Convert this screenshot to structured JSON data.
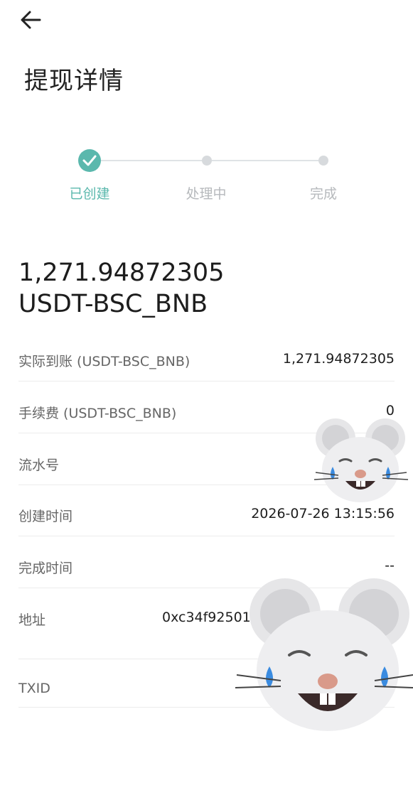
{
  "header": {
    "back_icon": "arrow-left-icon",
    "title": "提现详情"
  },
  "steps": [
    {
      "label": "已创建",
      "state": "done"
    },
    {
      "label": "处理中",
      "state": "pending"
    },
    {
      "label": "完成",
      "state": "pending"
    }
  ],
  "amount": {
    "value": "1,271.94872305",
    "currency": "USDT-BSC_BNB"
  },
  "details": {
    "received": {
      "label": "实际到账 (USDT-BSC_BNB)",
      "value": "1,271.94872305"
    },
    "fee": {
      "label": "手续费 (USDT-BSC_BNB)",
      "value": "0"
    },
    "serial": {
      "label": "流水号",
      "value": ""
    },
    "created": {
      "label": "创建时间",
      "value": "2026-07-26 13:15:56"
    },
    "completed": {
      "label": "完成时间",
      "value": "--"
    },
    "address": {
      "label": "地址",
      "value": "0xc34f92501"
    },
    "txid": {
      "label": "TXID",
      "value": ""
    }
  },
  "colors": {
    "accent": "#5bb8ad",
    "pending": "#d7dadd"
  },
  "overlays": [
    "crying-mouse-emoji",
    "crying-mouse-emoji"
  ]
}
